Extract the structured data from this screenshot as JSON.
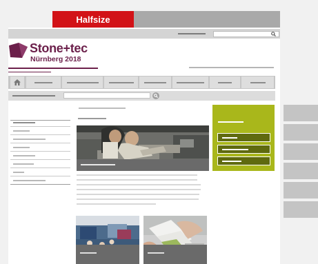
{
  "size_selector": {
    "half_label": "Halfsize"
  },
  "header": {
    "logo_name": "Stone+tec",
    "logo_subtitle": "Nürnberg 2018"
  },
  "colors": {
    "accent_red": "#d21217",
    "brand_purple": "#6b1f4a",
    "green_box": "#a9b71b",
    "caption_grey": "#6a6a6a"
  },
  "icons": {
    "home": "home-icon",
    "search": "search-icon"
  }
}
